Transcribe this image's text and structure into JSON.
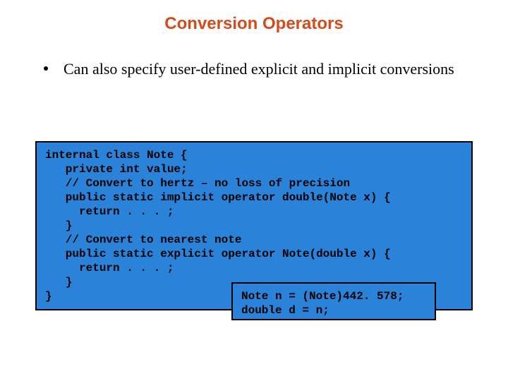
{
  "title": "Conversion Operators",
  "bullet": "Can also specify user-defined explicit and implicit conversions",
  "code_main": "internal class Note {\n   private int value;\n   // Convert to hertz – no loss of precision\n   public static implicit operator double(Note x) {\n     return . . . ;\n   }\n   // Convert to nearest note\n   public static explicit operator Note(double x) {\n     return . . . ;\n   }\n}",
  "code_small": "Note n = (Note)442. 578;\ndouble d = n;"
}
